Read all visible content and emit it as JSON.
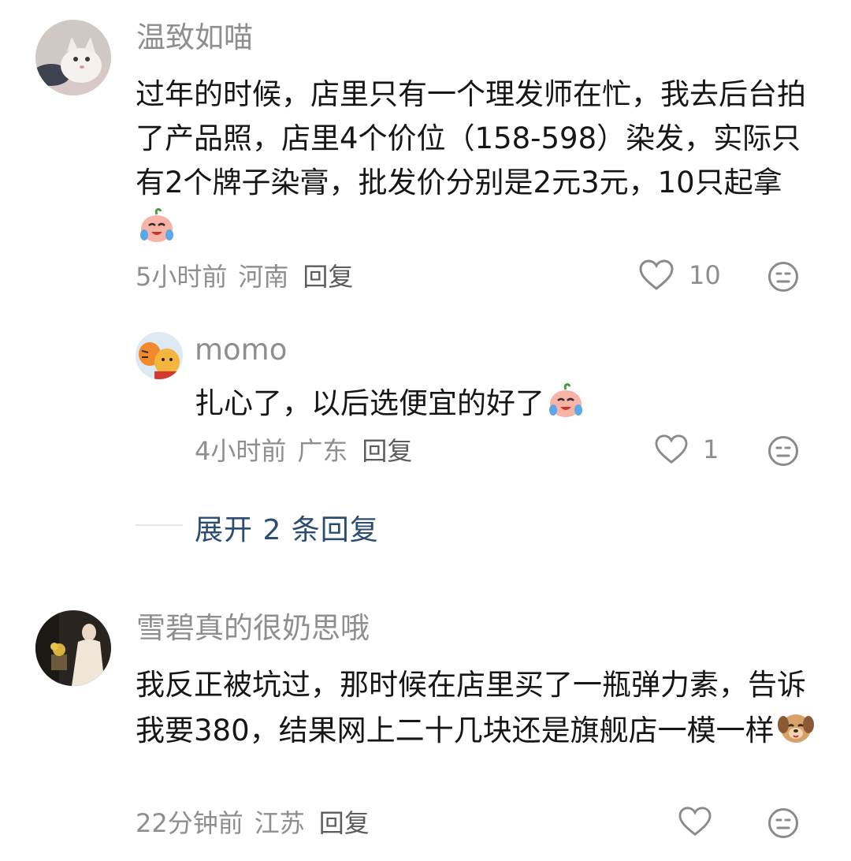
{
  "comments": [
    {
      "username": "温致如喵",
      "text": "过年的时候，店里只有一个理发师在忙，我去后台拍了产品照，店里4个价位（158-598）染发，实际只有2个牌子染膏，批发价分别是2元3元，10只起拿",
      "time": "5小时前",
      "location": "河南",
      "reply_label": "回复",
      "likes": "10",
      "emoji": "crying-laughing-peach",
      "avatar": "white-cat-avatar"
    },
    {
      "username": "momo",
      "text": "扎心了，以后选便宜的好了",
      "time": "4小时前",
      "location": "广东",
      "reply_label": "回复",
      "likes": "1",
      "emoji": "crying-laughing-peach",
      "avatar": "winnie-tigger-avatar"
    },
    {
      "username": "雪碧真的很奶思哦",
      "text": "我反正被坑过，那时候在店里买了一瓶弹力素，告诉我要380，结果网上二十几块还是旗舰店一模一样",
      "time": "22分钟前",
      "location": "江苏",
      "reply_label": "回复",
      "likes": "",
      "emoji": "dog-face",
      "avatar": "painting-lady-avatar"
    }
  ],
  "expand_replies": "展开 2 条回复",
  "icons": {
    "like": "heart-outline-icon",
    "dislike": "neutral-face-icon"
  },
  "colors": {
    "expand_link": "#2c4d72",
    "secondary_text": "#8e8e8e",
    "body_text": "#161616"
  }
}
